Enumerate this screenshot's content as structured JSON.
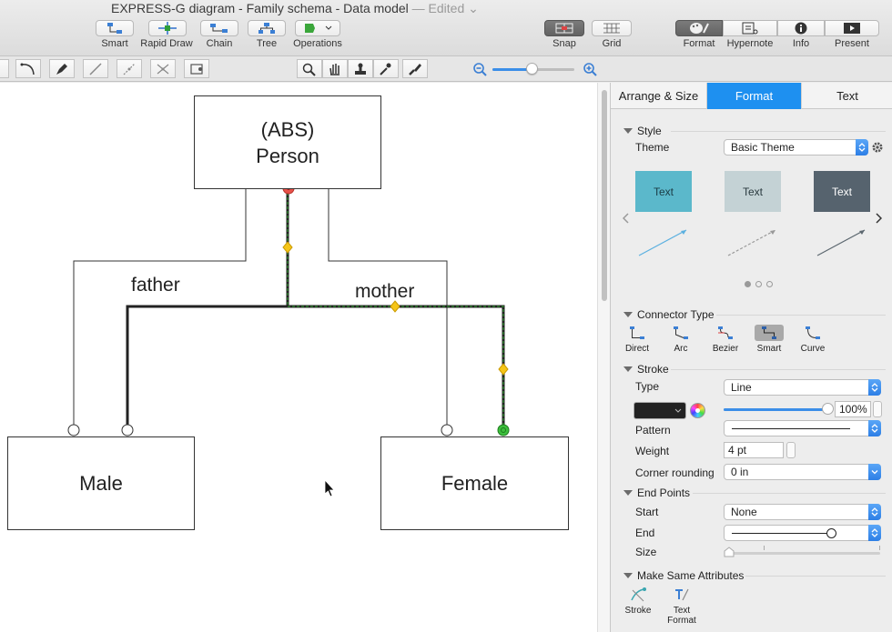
{
  "window": {
    "title": "EXPRESS-G diagram - Family schema - Data model",
    "edited": "— Edited"
  },
  "toolbar": {
    "left": [
      {
        "label": "Smart",
        "icon": "smart-icon"
      },
      {
        "label": "Rapid Draw",
        "icon": "rapid-draw-icon"
      },
      {
        "label": "Chain",
        "icon": "chain-icon"
      },
      {
        "label": "Tree",
        "icon": "tree-icon"
      },
      {
        "label": "Operations",
        "icon": "operations-icon"
      }
    ],
    "middle": [
      {
        "label": "Snap",
        "icon": "snap-icon",
        "active": true
      },
      {
        "label": "Grid",
        "icon": "grid-icon"
      }
    ],
    "right": [
      {
        "label": "Format",
        "icon": "format-icon",
        "active": true
      },
      {
        "label": "Hypernote",
        "icon": "hypernote-icon"
      },
      {
        "label": "Info",
        "icon": "info-icon"
      },
      {
        "label": "Present",
        "icon": "present-icon"
      }
    ]
  },
  "zoom": {
    "level": 0.48
  },
  "diagram": {
    "person": {
      "line1": "(ABS)",
      "line2": "Person"
    },
    "male": "Male",
    "female": "Female",
    "rel_father": "father",
    "rel_mother": "mother"
  },
  "inspector": {
    "tabs": [
      "Arrange & Size",
      "Format",
      "Text"
    ],
    "active_tab": "Format",
    "style": {
      "section": "Style",
      "theme_label": "Theme",
      "theme_value": "Basic Theme",
      "cards": [
        {
          "text": "Text",
          "bg": "#5bb8cb",
          "fg": "#1b3b45"
        },
        {
          "text": "Text",
          "bg": "#c4d2d5",
          "fg": "#2a3a3f"
        },
        {
          "text": "Text",
          "bg": "#56636e",
          "fg": "#ffffff"
        }
      ]
    },
    "connector": {
      "section": "Connector Type",
      "types": [
        "Direct",
        "Arc",
        "Bezier",
        "Smart",
        "Curve"
      ],
      "active": "Smart"
    },
    "stroke": {
      "section": "Stroke",
      "type_label": "Type",
      "type_value": "Line",
      "opacity_value": "100%",
      "opacity_level": 1.0,
      "pattern_label": "Pattern",
      "weight_label": "Weight",
      "weight_value": "4 pt",
      "corner_label": "Corner rounding",
      "corner_value": "0 in",
      "color": "#222222"
    },
    "endpoints": {
      "section": "End Points",
      "start_label": "Start",
      "start_value": "None",
      "end_label": "End",
      "size_label": "Size"
    },
    "same": {
      "section": "Make Same Attributes",
      "stroke_label": "Stroke",
      "text_format_label": "Text Format"
    }
  },
  "colors": {
    "accent": "#1e90f0",
    "selection_green": "#2ea52e",
    "handle_yellow": "#f5c518",
    "handle_red": "#e8524a"
  }
}
